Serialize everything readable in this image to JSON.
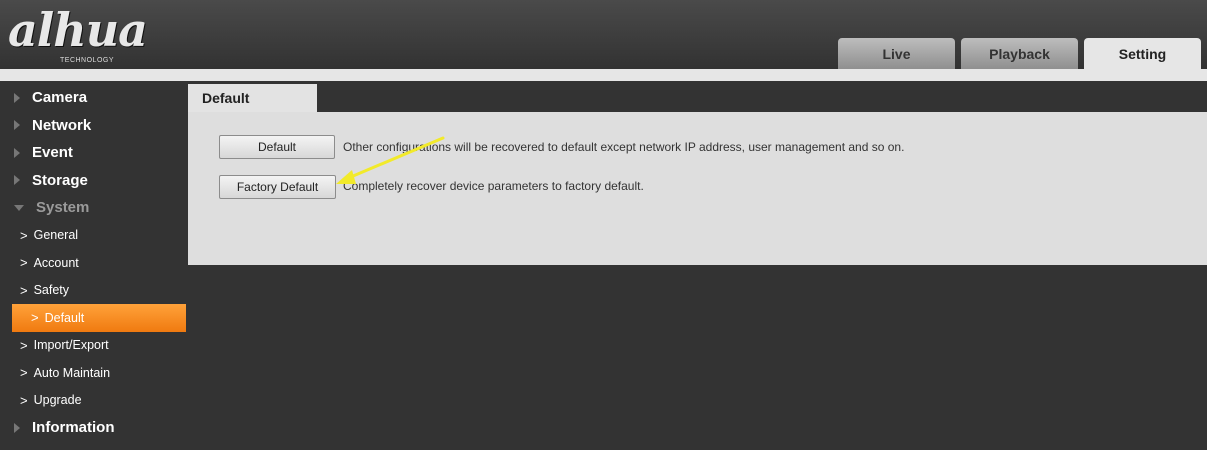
{
  "header": {
    "logo_text": "alhua",
    "logo_sub": "TECHNOLOGY",
    "tabs": [
      {
        "label": "Live"
      },
      {
        "label": "Playback"
      },
      {
        "label": "Setting"
      }
    ],
    "active_tab": "Setting"
  },
  "sidebar": {
    "menu": [
      {
        "label": "Camera"
      },
      {
        "label": "Network"
      },
      {
        "label": "Event"
      },
      {
        "label": "Storage"
      },
      {
        "label": "System"
      }
    ],
    "system_items": [
      {
        "label": "General"
      },
      {
        "label": "Account"
      },
      {
        "label": "Safety"
      },
      {
        "label": "Default"
      },
      {
        "label": "Import/Export"
      },
      {
        "label": "Auto Maintain"
      },
      {
        "label": "Upgrade"
      }
    ],
    "last_menu": {
      "label": "Information"
    },
    "active_item": "Default"
  },
  "content": {
    "tab_label": "Default",
    "default_button": "Default",
    "default_desc": "Other configurations will be recovered to default except network IP address, user management and so on.",
    "factory_button": "Factory Default",
    "factory_desc": "Completely recover device parameters to factory default."
  },
  "colors": {
    "accent": "#f58a1f",
    "annotation_arrow": "#f2ea2a"
  }
}
